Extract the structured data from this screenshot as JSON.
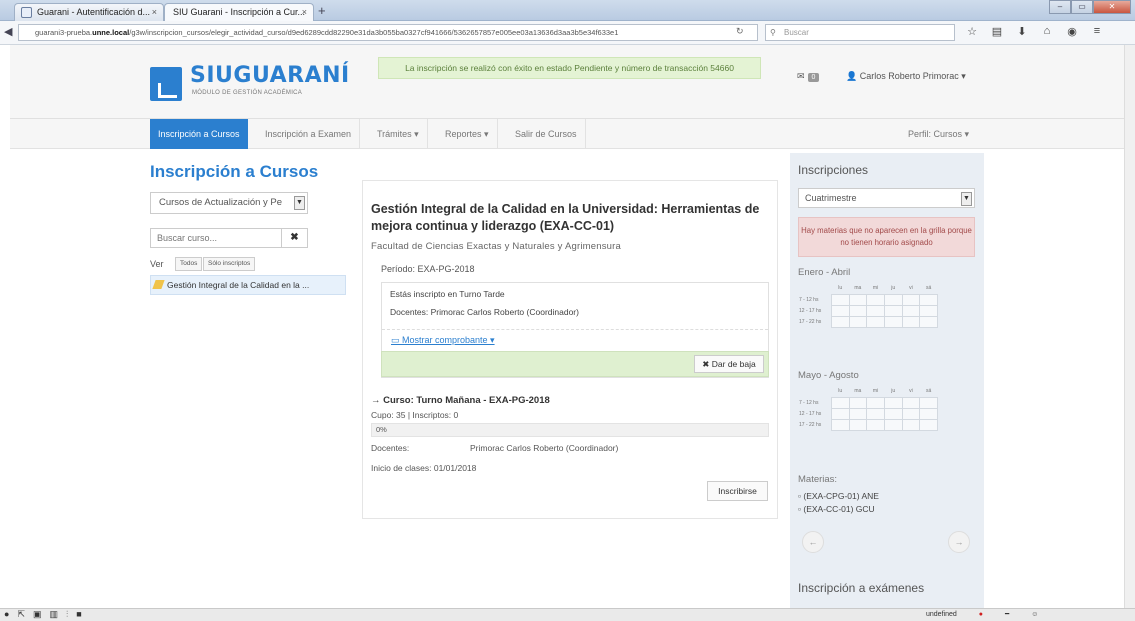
{
  "browser": {
    "tabs": [
      {
        "label": "Guarani - Autentificación d...",
        "close": "×"
      },
      {
        "label": "SIU Guarani - Inscripción a Cur...",
        "close": "×"
      }
    ],
    "new_tab": "+",
    "url_prefix": "guarani3-prueba.",
    "url_host": "unne.local",
    "url_rest": "/g3w/inscripcion_cursos/elegir_actividad_curso/d9ed6289cdd82290e31da3b055ba0327cf941666/5362657857e005ee03a13636d3aa3b5e34f633e1",
    "search_placeholder": "Buscar",
    "status_text": "undefined"
  },
  "header": {
    "logo_title_a": "SIU",
    "logo_title_b": "GUARANÍ",
    "logo_subtitle": "MÓDULO DE GESTIÓN ACADÉMICA",
    "alert": "La inscripción se realizó con éxito en estado Pendiente y número de transacción 54660",
    "mail_count": "0",
    "user_name": "Carlos Roberto Primorac ▾"
  },
  "menu": {
    "items": [
      "Inscripción a Cursos",
      "Inscripción a Examen",
      "Trámites ▾",
      "Reportes ▾",
      "Salir de Cursos"
    ],
    "perfil": "Perfil: Cursos ▾"
  },
  "left": {
    "title": "Inscripción a Cursos",
    "select_value": "Cursos de Actualización y Pe",
    "search_placeholder": "Buscar curso...",
    "ver_label": "Ver",
    "filter_all": "Todos",
    "filter_mine": "Sólo inscriptos",
    "course_item": "Gestión Integral de la Calidad en la ..."
  },
  "detail": {
    "title": "Gestión Integral de la Calidad en la Universidad: Herramientas de mejora continua y liderazgo (EXA-CC-01)",
    "faculty": "Facultad de Ciencias Exactas y Naturales y Agrimensura",
    "period": "Período: EXA-PG-2018",
    "inscribed_turn": "Estás inscripto en Turno Tarde",
    "teachers": "Docentes: Primorac Carlos Roberto (Coordinador)",
    "show_receipt": "Mostrar comprobante ▾",
    "drop_button": "Dar de baja",
    "course_heading": "→ Curso: Turno Mañana - EXA-PG-2018",
    "cupo": "Cupo: 35 | Inscriptos: 0",
    "progress_label": "0%",
    "progress_value": 0,
    "docentes_label": "Docentes:",
    "docentes_value": "Primorac Carlos Roberto (Coordinador)",
    "start_date": "Inicio de clases: 01/01/2018",
    "enroll_button": "Inscribirse"
  },
  "sidebar": {
    "title": "Inscripciones",
    "select_value": "Cuatrimestre",
    "warning": "Hay materias que no aparecen en la grilla porque no tienen horario asignado",
    "semester1": "Enero - Abril",
    "semester2": "Mayo - Agosto",
    "days": [
      "lu",
      "ma",
      "mi",
      "ju",
      "vi",
      "sá"
    ],
    "slots": [
      "7 - 12 hs",
      "12 - 17 hs",
      "17 - 22 hs"
    ],
    "materias_title": "Materias:",
    "materias": [
      "(EXA-CPG-01) ANE",
      "(EXA-CC-01) GCU"
    ],
    "prev": "←",
    "next": "→",
    "bottom_title": "Inscripción a exámenes"
  }
}
